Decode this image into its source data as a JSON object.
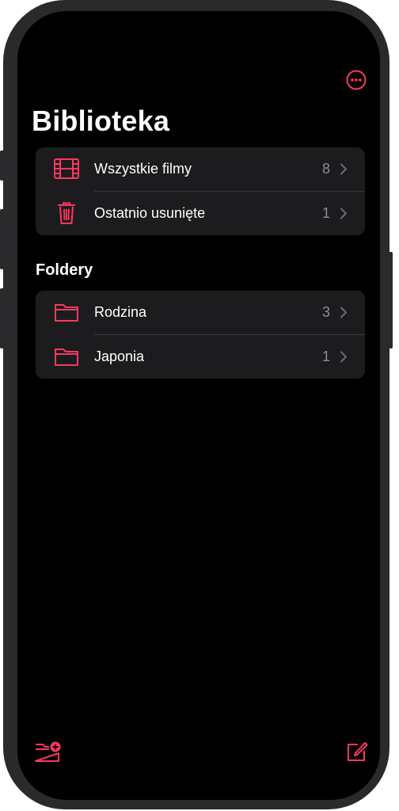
{
  "colors": {
    "accent": "#ff375f",
    "background": "#000000",
    "group_background": "#1c1c1e",
    "secondary_text": "#8e8e93"
  },
  "header": {
    "more_icon": "ellipsis-circle-icon",
    "title": "Biblioteka"
  },
  "library": {
    "items": [
      {
        "icon": "film-icon",
        "label": "Wszystkie filmy",
        "count": "8"
      },
      {
        "icon": "trash-icon",
        "label": "Ostatnio usunięte",
        "count": "1"
      }
    ]
  },
  "folders": {
    "title": "Foldery",
    "items": [
      {
        "icon": "folder-icon",
        "label": "Rodzina",
        "count": "3"
      },
      {
        "icon": "folder-icon",
        "label": "Japonia",
        "count": "1"
      }
    ]
  },
  "toolbar": {
    "new_folder_icon": "folder-badge-plus-icon",
    "compose_icon": "square-and-pencil-icon"
  }
}
